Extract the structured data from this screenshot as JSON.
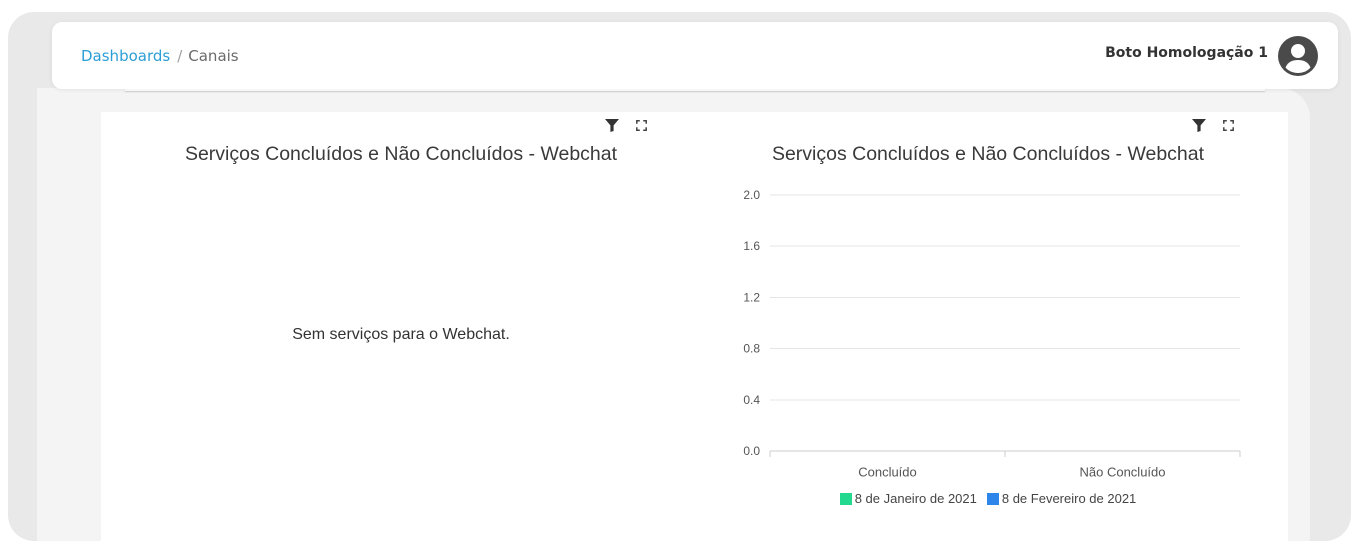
{
  "header": {
    "breadcrumb": {
      "link_label": "Dashboards",
      "separator": "/",
      "current": "Canais"
    },
    "user_name": "Boto Homologação 1",
    "avatar_icon": "account-circle-icon"
  },
  "colors": {
    "breadcrumb_link": "#2c9ed6"
  },
  "chart_tools": {
    "filter_icon": "filter-icon",
    "expand_icon": "expand-icon"
  },
  "chart_data": [
    {
      "title": "Serviços Concluídos e Não Concluídos - Webchat",
      "categories": [],
      "series": [],
      "message": "Sem serviços para o Webchat."
    },
    {
      "type": "bar",
      "title": "Serviços Concluídos e Não Concluídos - Webchat",
      "categories": [
        "Concluído",
        "Não Concluído"
      ],
      "series": [
        {
          "name": "8 de Janeiro de 2021",
          "color": "#22d98f",
          "values": [
            0,
            0
          ]
        },
        {
          "name": "8 de Fevereiro de 2021",
          "color": "#2e86ea",
          "values": [
            0,
            0
          ]
        }
      ],
      "ylim": [
        0,
        2
      ],
      "ytick_labels": [
        "0.0",
        "0.4",
        "0.8",
        "1.2",
        "1.6",
        "2.0"
      ],
      "grid": true,
      "legend": "bottom"
    }
  ]
}
